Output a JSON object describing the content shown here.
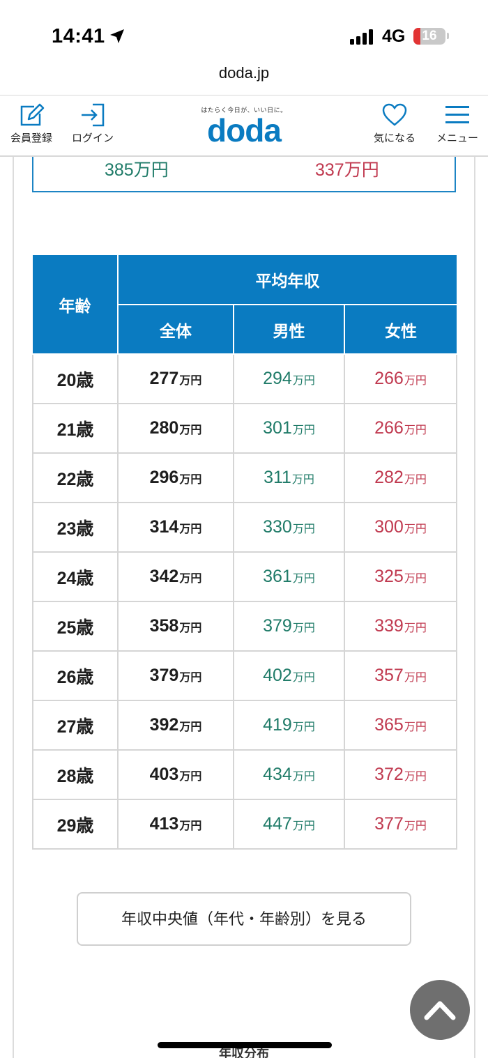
{
  "status_bar": {
    "time": "14:41",
    "network": "4G",
    "battery": "16"
  },
  "url": "doda.jp",
  "header": {
    "register_label": "会員登録",
    "login_label": "ログイン",
    "tagline": "はたらく今日が、いい日に。",
    "logo": "doda",
    "favorite_label": "気になる",
    "menu_label": "メニュー",
    "brand_color": "#0a7bc1"
  },
  "summary": {
    "male": "385万円",
    "female": "337万円"
  },
  "table": {
    "headers": {
      "age": "年齢",
      "average": "平均年収",
      "all": "全体",
      "male": "男性",
      "female": "女性"
    },
    "unit": "万円",
    "rows": [
      {
        "age": "20歳",
        "all": "277",
        "male": "294",
        "female": "266"
      },
      {
        "age": "21歳",
        "all": "280",
        "male": "301",
        "female": "266"
      },
      {
        "age": "22歳",
        "all": "296",
        "male": "311",
        "female": "282"
      },
      {
        "age": "23歳",
        "all": "314",
        "male": "330",
        "female": "300"
      },
      {
        "age": "24歳",
        "all": "342",
        "male": "361",
        "female": "325"
      },
      {
        "age": "25歳",
        "all": "358",
        "male": "379",
        "female": "339"
      },
      {
        "age": "26歳",
        "all": "379",
        "male": "402",
        "female": "357"
      },
      {
        "age": "27歳",
        "all": "392",
        "male": "419",
        "female": "365"
      },
      {
        "age": "28歳",
        "all": "403",
        "male": "434",
        "female": "372"
      },
      {
        "age": "29歳",
        "all": "413",
        "male": "447",
        "female": "377"
      }
    ]
  },
  "median_button_label": "年収中央値（年代・年齢別）を見る",
  "next_heading": "年収分布",
  "colors": {
    "male": "#1f7b68",
    "female": "#c0394f",
    "header_bg": "#0a7bc1"
  }
}
